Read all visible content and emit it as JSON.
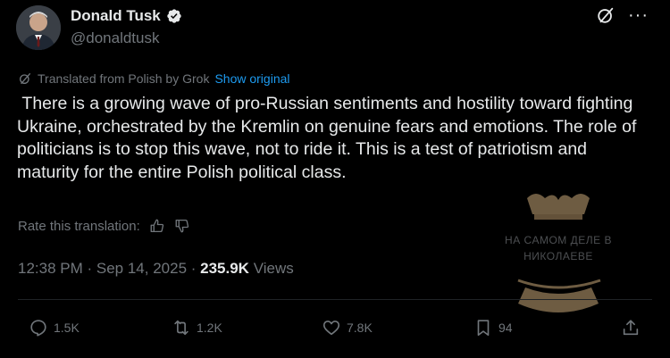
{
  "header": {
    "display_name": "Donald Tusk",
    "handle": "@donaldtusk"
  },
  "translation": {
    "label": "Translated from Polish by Grok",
    "show_original": "Show original"
  },
  "tweet": {
    "text": " There is a growing wave of pro-Russian sentiments and hostility toward fighting Ukraine, orchestrated by the Kremlin on genuine fears and emotions. The role of politicians is to stop this wave, not to ride it. This is a test of patriotism and maturity for the entire Polish political class."
  },
  "rate": {
    "label": "Rate this translation:"
  },
  "meta": {
    "time": "12:38 PM",
    "separator": " · ",
    "date": "Sep 14, 2025",
    "views_count": "235.9K",
    "views_label": " Views"
  },
  "actions": {
    "replies": "1.5K",
    "reposts": "1.2K",
    "likes": "7.8K",
    "bookmarks": "94"
  },
  "watermark": {
    "line1": "НА САМОМ ДЕЛЕ В",
    "line2": "НИКОЛАЕВЕ"
  },
  "colors": {
    "background": "#000000",
    "text": "#e7e9ea",
    "muted": "#71767b",
    "link": "#1d9bf0",
    "verified": "#ffffff"
  }
}
